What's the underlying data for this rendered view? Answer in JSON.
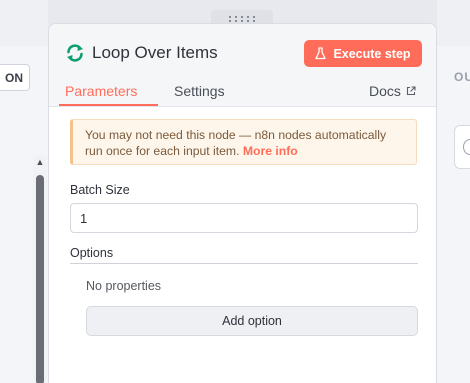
{
  "canvas": {
    "left_button_label": "ON",
    "right_label": "OU"
  },
  "node": {
    "title": "Loop Over Items",
    "icon": "loop-arrows-icon",
    "execute_label": "Execute step",
    "execute_icon": "flask-icon"
  },
  "tabs": {
    "parameters": "Parameters",
    "settings": "Settings",
    "docs": "Docs",
    "docs_icon": "external-link-icon"
  },
  "callout": {
    "text": "You may not need this node — n8n nodes automatically run once for each input item. ",
    "link": "More info"
  },
  "fields": {
    "batch_size_label": "Batch Size",
    "batch_size_value": "1",
    "options_label": "Options",
    "no_properties": "No properties",
    "add_option": "Add option"
  },
  "colors": {
    "accent": "#ff6d5a",
    "success_icon": "#0e9f6e",
    "callout_bg": "#fef6ea"
  }
}
